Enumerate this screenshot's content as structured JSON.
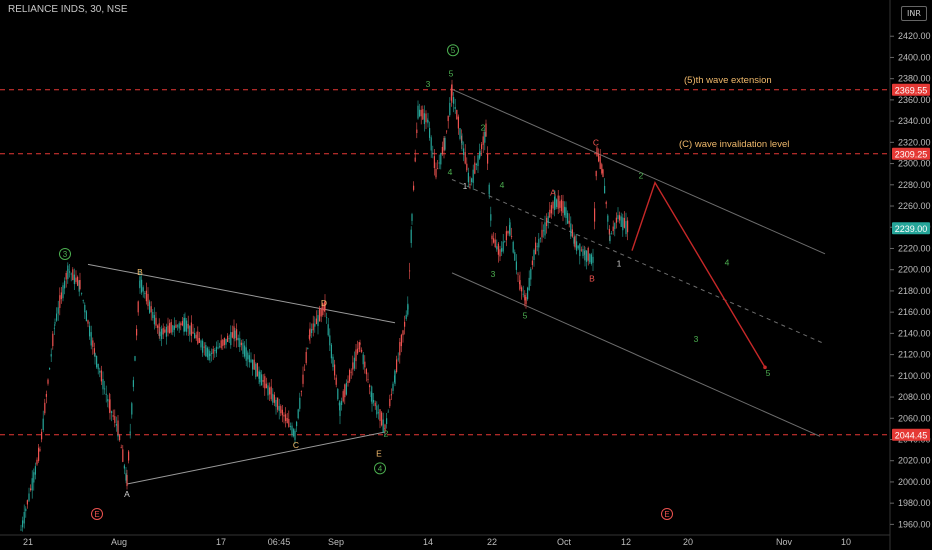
{
  "header": {
    "title": "RELIANCE INDS, 30, NSE",
    "currency": "INR"
  },
  "chart_data": {
    "type": "line",
    "title": "RELIANCE INDS, 30, NSE",
    "ylim": [
      1950,
      2440
    ],
    "grid": false,
    "y_ticks": [
      2420,
      2400,
      2380,
      2360,
      2340,
      2320,
      2300,
      2280,
      2260,
      2240,
      2220,
      2200,
      2180,
      2160,
      2140,
      2120,
      2100,
      2080,
      2060,
      2040,
      2020,
      2000,
      1980,
      1960
    ],
    "x_ticks": [
      "21",
      "Aug",
      "10",
      "17",
      "06:45",
      "Sep",
      "14",
      "22",
      "Oct",
      "12",
      "20",
      "Nov",
      "10"
    ],
    "price_labels": [
      {
        "value": 2369.55,
        "label": "2369.55",
        "color": "#e53935"
      },
      {
        "value": 2309.25,
        "label": "2309.25",
        "color": "#e53935"
      },
      {
        "value": 2239.0,
        "label": "2239.00",
        "color": "#26a69a"
      },
      {
        "value": 2044.45,
        "label": "2044.45",
        "color": "#e53935"
      }
    ],
    "horizontal_levels": [
      {
        "value": 2369.55,
        "text": "(5)th wave extension",
        "color": "#f0b96b"
      },
      {
        "value": 2309.25,
        "text": "(C) wave invalidation level",
        "color": "#f0b96b"
      },
      {
        "value": 2044.45,
        "text": "",
        "color": "#e53935"
      }
    ],
    "price_path": [
      {
        "x": 21,
        "y": 1955
      },
      {
        "x": 40,
        "y": 2030
      },
      {
        "x": 55,
        "y": 2150
      },
      {
        "x": 68,
        "y": 2200
      },
      {
        "x": 80,
        "y": 2185
      },
      {
        "x": 95,
        "y": 2120
      },
      {
        "x": 110,
        "y": 2070
      },
      {
        "x": 118,
        "y": 2050
      },
      {
        "x": 127,
        "y": 2000
      },
      {
        "x": 140,
        "y": 2190
      },
      {
        "x": 160,
        "y": 2140
      },
      {
        "x": 185,
        "y": 2150
      },
      {
        "x": 210,
        "y": 2120
      },
      {
        "x": 235,
        "y": 2140
      },
      {
        "x": 260,
        "y": 2100
      },
      {
        "x": 295,
        "y": 2045
      },
      {
        "x": 310,
        "y": 2140
      },
      {
        "x": 325,
        "y": 2165
      },
      {
        "x": 340,
        "y": 2070
      },
      {
        "x": 360,
        "y": 2130
      },
      {
        "x": 372,
        "y": 2080
      },
      {
        "x": 385,
        "y": 2050
      },
      {
        "x": 395,
        "y": 2100
      },
      {
        "x": 408,
        "y": 2165
      },
      {
        "x": 412,
        "y": 2250
      },
      {
        "x": 418,
        "y": 2350
      },
      {
        "x": 428,
        "y": 2340
      },
      {
        "x": 436,
        "y": 2290
      },
      {
        "x": 445,
        "y": 2320
      },
      {
        "x": 452,
        "y": 2368
      },
      {
        "x": 462,
        "y": 2320
      },
      {
        "x": 470,
        "y": 2280
      },
      {
        "x": 480,
        "y": 2310
      },
      {
        "x": 486,
        "y": 2330
      },
      {
        "x": 492,
        "y": 2230
      },
      {
        "x": 500,
        "y": 2215
      },
      {
        "x": 510,
        "y": 2240
      },
      {
        "x": 520,
        "y": 2185
      },
      {
        "x": 526,
        "y": 2170
      },
      {
        "x": 534,
        "y": 2215
      },
      {
        "x": 545,
        "y": 2240
      },
      {
        "x": 555,
        "y": 2265
      },
      {
        "x": 566,
        "y": 2255
      },
      {
        "x": 575,
        "y": 2225
      },
      {
        "x": 585,
        "y": 2215
      },
      {
        "x": 593,
        "y": 2210
      },
      {
        "x": 597,
        "y": 2310
      },
      {
        "x": 603,
        "y": 2290
      },
      {
        "x": 610,
        "y": 2230
      },
      {
        "x": 618,
        "y": 2250
      },
      {
        "x": 628,
        "y": 2239
      }
    ],
    "projection_path": [
      {
        "x": 632,
        "y": 2218
      },
      {
        "x": 655,
        "y": 2282
      },
      {
        "x": 765,
        "y": 2108
      }
    ],
    "trendlines": [
      {
        "p1": {
          "x": 88,
          "y": 2205
        },
        "p2": {
          "x": 395,
          "y": 2150
        },
        "color": "#9a9a9a",
        "dashed": false
      },
      {
        "p1": {
          "x": 127,
          "y": 1998
        },
        "p2": {
          "x": 385,
          "y": 2047
        },
        "color": "#9a9a9a",
        "dashed": false
      },
      {
        "p1": {
          "x": 452,
          "y": 2370
        },
        "p2": {
          "x": 825,
          "y": 2215
        },
        "color": "#6d6d6d",
        "dashed": false
      },
      {
        "p1": {
          "x": 452,
          "y": 2197
        },
        "p2": {
          "x": 820,
          "y": 2043
        },
        "color": "#6d6d6d",
        "dashed": false
      },
      {
        "p1": {
          "x": 452,
          "y": 2285
        },
        "p2": {
          "x": 825,
          "y": 2130
        },
        "color": "#6d6d6d",
        "dashed": true
      }
    ],
    "wave_labels": [
      {
        "text": "3",
        "x": 65,
        "y": 2212,
        "color": "#4caf50",
        "circled": true
      },
      {
        "text": "B",
        "x": 140,
        "y": 2195,
        "color": "#f0b96b",
        "circled": false
      },
      {
        "text": "A",
        "x": 127,
        "y": 1986,
        "color": "#cfcfcf",
        "circled": false
      },
      {
        "text": "D",
        "x": 324,
        "y": 2166,
        "color": "#f0b96b",
        "circled": false
      },
      {
        "text": "C",
        "x": 296,
        "y": 2032,
        "color": "#f0b96b",
        "circled": false
      },
      {
        "text": "2",
        "x": 386,
        "y": 2043,
        "color": "#4caf50",
        "circled": false
      },
      {
        "text": "E",
        "x": 379,
        "y": 2024,
        "color": "#f0b96b",
        "circled": false
      },
      {
        "text": "4",
        "x": 380,
        "y": 2010,
        "color": "#4caf50",
        "circled": true
      },
      {
        "text": "5",
        "x": 453,
        "y": 2404,
        "color": "#4caf50",
        "circled": true
      },
      {
        "text": "5",
        "x": 451,
        "y": 2382,
        "color": "#4caf50",
        "circled": false
      },
      {
        "text": "3",
        "x": 428,
        "y": 2372,
        "color": "#4caf50",
        "circled": false
      },
      {
        "text": "4",
        "x": 450,
        "y": 2289,
        "color": "#4caf50",
        "circled": false
      },
      {
        "text": "1",
        "x": 465,
        "y": 2276,
        "color": "#cfcfcf",
        "circled": false
      },
      {
        "text": "2",
        "x": 483,
        "y": 2331,
        "color": "#4caf50",
        "circled": false
      },
      {
        "text": "4",
        "x": 502,
        "y": 2277,
        "color": "#4caf50",
        "circled": false
      },
      {
        "text": "3",
        "x": 493,
        "y": 2193,
        "color": "#4caf50",
        "circled": false
      },
      {
        "text": "5",
        "x": 525,
        "y": 2154,
        "color": "#4caf50",
        "circled": false
      },
      {
        "text": "A",
        "x": 553,
        "y": 2270,
        "color": "#ef5350",
        "circled": false
      },
      {
        "text": "B",
        "x": 592,
        "y": 2189,
        "color": "#ef5350",
        "circled": false
      },
      {
        "text": "C",
        "x": 596,
        "y": 2317,
        "color": "#ef5350",
        "circled": false
      },
      {
        "text": "1",
        "x": 619,
        "y": 2203,
        "color": "#cfcfcf",
        "circled": false
      },
      {
        "text": "2",
        "x": 641,
        "y": 2286,
        "color": "#4caf50",
        "circled": false
      },
      {
        "text": "4",
        "x": 727,
        "y": 2204,
        "color": "#4caf50",
        "circled": false
      },
      {
        "text": "3",
        "x": 696,
        "y": 2132,
        "color": "#4caf50",
        "circled": false
      },
      {
        "text": "5",
        "x": 768,
        "y": 2100,
        "color": "#4caf50",
        "circled": false
      },
      {
        "text": "E",
        "x": 97,
        "y": 1967,
        "color": "#ef5350",
        "circled": true
      },
      {
        "text": "E",
        "x": 667,
        "y": 1967,
        "color": "#ef5350",
        "circled": true
      }
    ]
  }
}
